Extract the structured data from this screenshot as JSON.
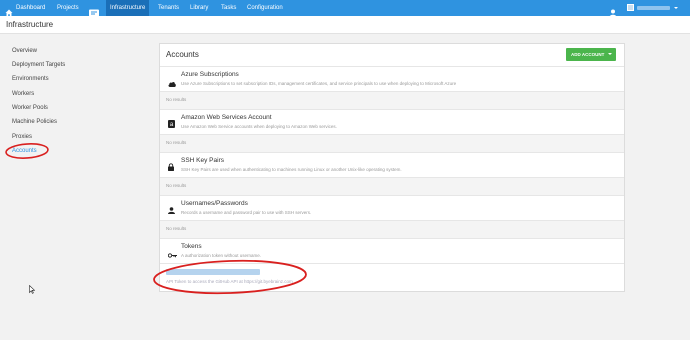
{
  "topnav": {
    "items": [
      {
        "label": "Dashboard"
      },
      {
        "label": "Projects"
      },
      {
        "label": "Infrastructure"
      },
      {
        "label": "Tenants"
      },
      {
        "label": "Library"
      },
      {
        "label": "Tasks"
      },
      {
        "label": "Configuration"
      }
    ],
    "icons": [
      "home-icon",
      "list-icon",
      "user-icon"
    ],
    "accent": "#2f93e0",
    "active_bg": "#1a6fb8"
  },
  "subheader": {
    "title": "Infrastructure"
  },
  "sidebar": {
    "items": [
      {
        "label": "Overview"
      },
      {
        "label": "Deployment Targets"
      },
      {
        "label": "Environments"
      },
      {
        "label": "Workers"
      },
      {
        "label": "Worker Pools"
      },
      {
        "label": "Machine Policies"
      },
      {
        "label": "Proxies"
      },
      {
        "label": "Accounts"
      }
    ],
    "active": "Accounts"
  },
  "panel": {
    "title": "Accounts",
    "add_button": "ADD ACCOUNT",
    "add_button_color": "#4bb54c",
    "sections": [
      {
        "icon": "cloud-icon",
        "title": "Azure Subscriptions",
        "description": "Use Azure Subscriptions to set subscription IDs, management certificates, and service principals to use when deploying to Microsoft Azure",
        "empty_text": "No results"
      },
      {
        "icon": "amazon-icon",
        "title": "Amazon Web Services Account",
        "description": "Use Amazon Web Service accounts when deploying to Amazon Web services.",
        "empty_text": "No results"
      },
      {
        "icon": "lock-icon",
        "title": "SSH Key Pairs",
        "description": "SSH Key Pairs are used when authenticating to machines running Linux or another Unix-like operating system.",
        "empty_text": "No results"
      },
      {
        "icon": "user-icon",
        "title": "Usernames/Passwords",
        "description": "Records a username and password pair to use with SSH servers.",
        "empty_text": "No results"
      },
      {
        "icon": "key-icon",
        "title": "Tokens",
        "description": "A authorization token without username."
      }
    ],
    "token_entry": {
      "description": "API Token to access the GitHub API at https://git.byebrainz.com"
    }
  },
  "annotation_color": "#d9201f"
}
